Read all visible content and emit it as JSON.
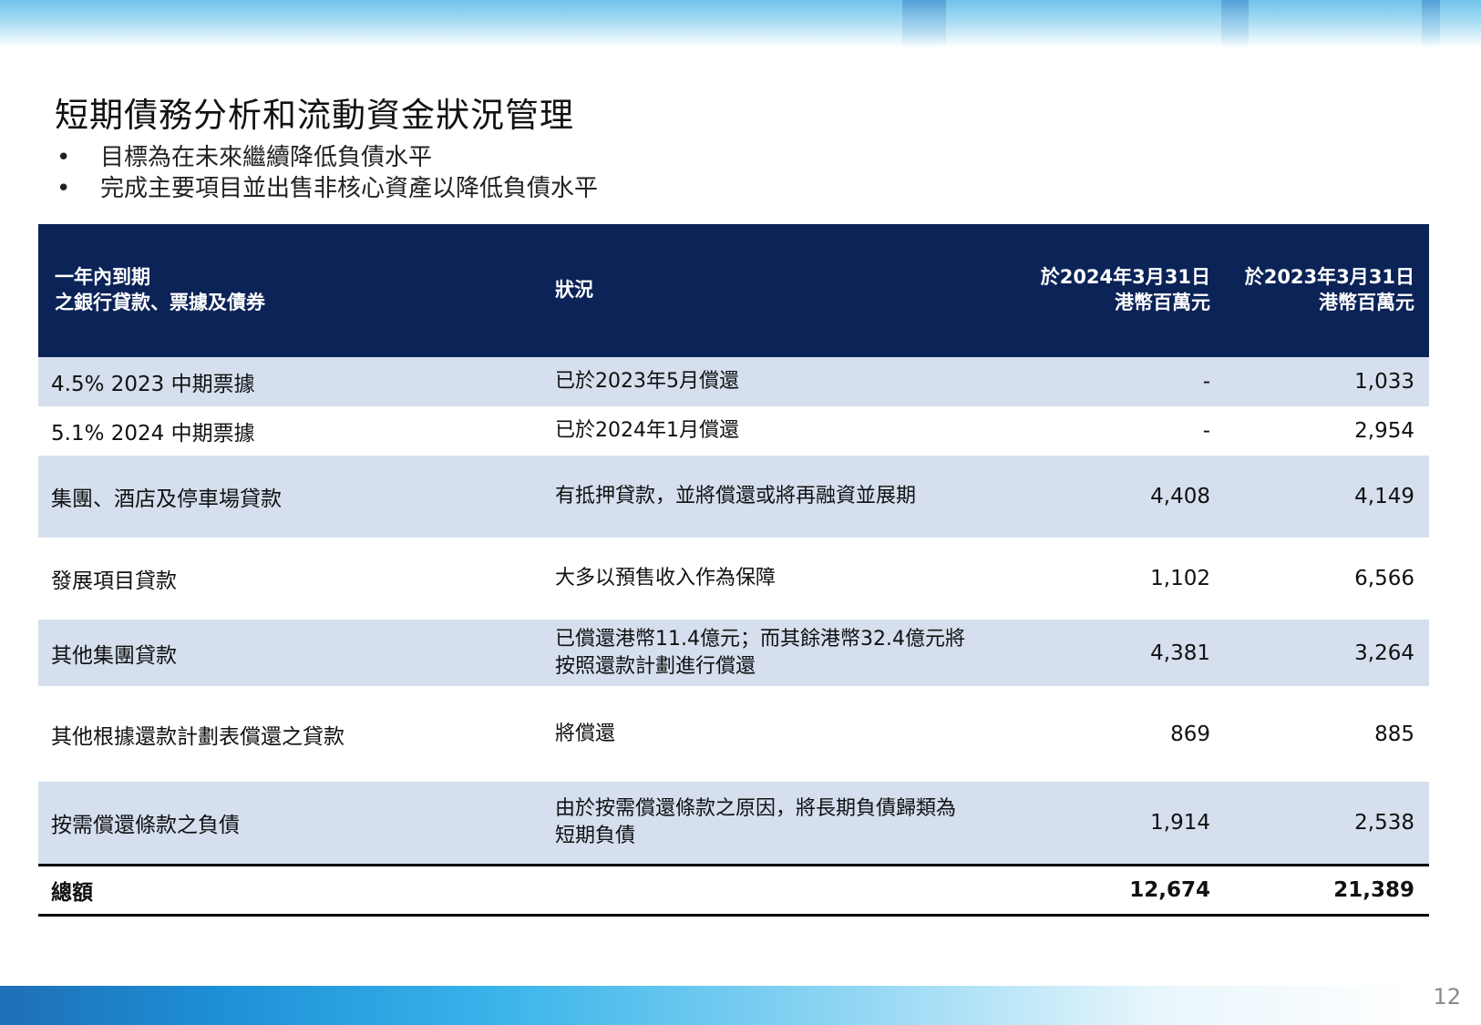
{
  "title": "短期債務分析和流動資金狀況管理",
  "bullets": [
    "目標為在未來繼續降低負債水平",
    "完成主要項目並出售非核心資產以降低負債水平"
  ],
  "table": {
    "headers": {
      "col1_line1": "一年內到期",
      "col1_line2": "之銀行貸款、票據及債券",
      "col2": "狀況",
      "col3_line1": "於2024年3月31日",
      "col3_line2": "港幣百萬元",
      "col4_line1": "於2023年3月31日",
      "col4_line2": "港幣百萬元"
    },
    "rows": [
      {
        "name": "4.5% 2023 中期票據",
        "status_line1": "已於2023年5月償還",
        "status_line2": "",
        "v2024": "-",
        "v2023": "1,033"
      },
      {
        "name": "5.1% 2024 中期票據",
        "status_line1": "已於2024年1月償還",
        "status_line2": "",
        "v2024": "-",
        "v2023": "2,954"
      },
      {
        "name": "集團、酒店及停車場貸款",
        "status_line1": "有抵押貸款，並將償還或將再融資並展期",
        "status_line2": "",
        "v2024": "4,408",
        "v2023": "4,149"
      },
      {
        "name": "發展項目貸款",
        "status_line1": "大多以預售收入作為保障",
        "status_line2": "",
        "v2024": "1,102",
        "v2023": "6,566"
      },
      {
        "name": "其他集團貸款",
        "status_line1": "已償還港幣11.4億元；而其餘港幣32.4億元將",
        "status_line2": "按照還款計劃進行償還",
        "v2024": "4,381",
        "v2023": "3,264"
      },
      {
        "name": "其他根據還款計劃表償還之貸款",
        "status_line1": "將償還",
        "status_line2": "",
        "v2024": "869",
        "v2023": "885"
      },
      {
        "name": "按需償還條款之負債",
        "status_line1": "由於按需償還條款之原因，將長期負債歸類為",
        "status_line2": "短期負債",
        "v2024": "1,914",
        "v2023": "2,538"
      }
    ],
    "total": {
      "name": "總額",
      "v2024": "12,674",
      "v2023": "21,389"
    }
  },
  "page_number": "12",
  "colors": {
    "header_bg": "#0b2357",
    "row_shade": "#d5dfee"
  }
}
